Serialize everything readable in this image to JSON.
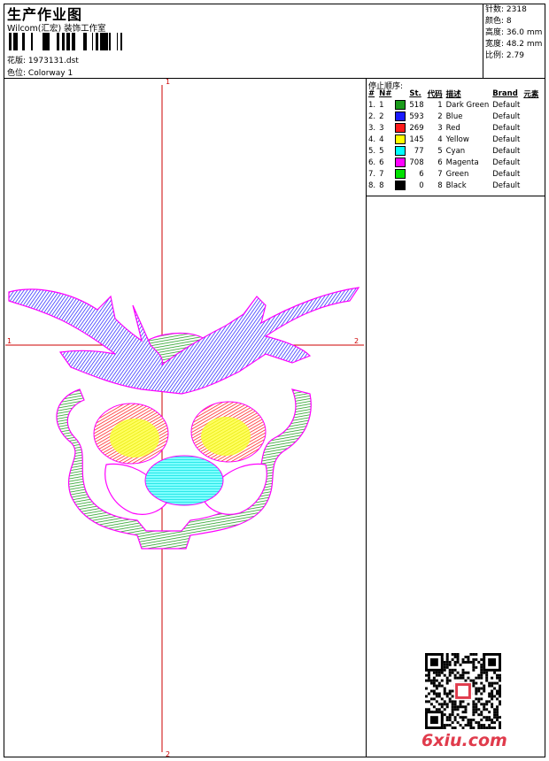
{
  "header": {
    "title": "生产作业图",
    "company": "Wilcom(汇宏) 装饰工作室",
    "design_label": "花版:",
    "design_value": "1973131.dst",
    "colorway_label": "色位:",
    "colorway_value": "Colorway 1"
  },
  "stats": [
    {
      "label": "针数:",
      "value": "2318"
    },
    {
      "label": "颜色:",
      "value": "8"
    },
    {
      "label": "高度:",
      "value": "36.0 mm"
    },
    {
      "label": "宽度:",
      "value": "48.2 mm"
    },
    {
      "label": "比例:",
      "value": "2.79"
    }
  ],
  "sequence": {
    "title": "停止顺序:",
    "columns": [
      "#",
      "N#",
      "St.",
      "代码",
      "描述",
      "Brand",
      "元素"
    ],
    "rows": [
      {
        "idx": "1.",
        "n": "1",
        "color": "#1a9a1a",
        "st": "518",
        "code": "1",
        "desc": "Dark Green",
        "brand": "Default"
      },
      {
        "idx": "2.",
        "n": "2",
        "color": "#1a1aff",
        "st": "593",
        "code": "2",
        "desc": "Blue",
        "brand": "Default"
      },
      {
        "idx": "3.",
        "n": "3",
        "color": "#ff1a1a",
        "st": "269",
        "code": "3",
        "desc": "Red",
        "brand": "Default"
      },
      {
        "idx": "4.",
        "n": "4",
        "color": "#ffff00",
        "st": "145",
        "code": "4",
        "desc": "Yellow",
        "brand": "Default"
      },
      {
        "idx": "5.",
        "n": "5",
        "color": "#00ffff",
        "st": "77",
        "code": "5",
        "desc": "Cyan",
        "brand": "Default"
      },
      {
        "idx": "6.",
        "n": "6",
        "color": "#ff00ff",
        "st": "708",
        "code": "6",
        "desc": "Magenta",
        "brand": "Default"
      },
      {
        "idx": "7.",
        "n": "7",
        "color": "#00e000",
        "st": "6",
        "code": "7",
        "desc": "Green",
        "brand": "Default"
      },
      {
        "idx": "8.",
        "n": "8",
        "color": "#000000",
        "st": "0",
        "code": "8",
        "desc": "Black",
        "brand": "Default"
      }
    ]
  },
  "axis": {
    "top": "1",
    "bottom": "2",
    "left": "1",
    "right": "2"
  },
  "watermark": "6xiu.com",
  "colors": {
    "axis": "#cc0000",
    "dark_green": "#1a9a1a",
    "blue": "#1a1aff",
    "red": "#ff1a1a",
    "yellow": "#ffff00",
    "cyan": "#00ffff",
    "magenta": "#ff00ff"
  }
}
